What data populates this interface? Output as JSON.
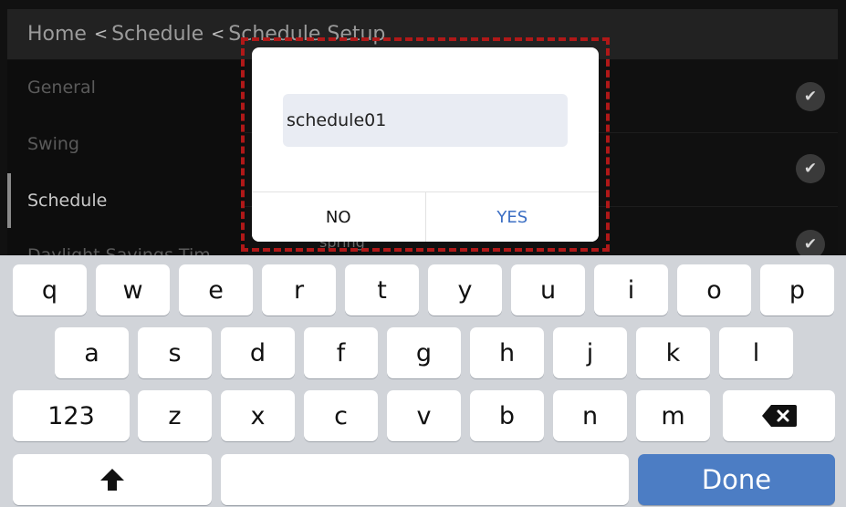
{
  "breadcrumb": {
    "home": "Home",
    "schedule": "Schedule",
    "current": "Schedule Setup",
    "separator": "<"
  },
  "sidebar": {
    "items": [
      {
        "label": "General"
      },
      {
        "label": "Swing"
      },
      {
        "label": "Schedule"
      },
      {
        "label": "Daylight Savings Tim"
      }
    ]
  },
  "list": {
    "peek_text": "spring",
    "check_icon": "checkmark-icon"
  },
  "dialog": {
    "input_value": "schedule01",
    "no_label": "NO",
    "yes_label": "YES"
  },
  "keyboard": {
    "row1": [
      "q",
      "w",
      "e",
      "r",
      "t",
      "y",
      "u",
      "i",
      "o",
      "p"
    ],
    "row2": [
      "a",
      "s",
      "d",
      "f",
      "g",
      "h",
      "j",
      "k",
      "l"
    ],
    "row3_mode": "123",
    "row3": [
      "z",
      "x",
      "c",
      "v",
      "b",
      "n",
      "m"
    ],
    "done_label": "Done",
    "shift_icon": "shift-icon",
    "backspace_icon": "backspace-icon"
  },
  "colors": {
    "accent_blue": "#4c7dc4",
    "yes_text": "#3c6fc4",
    "dialog_highlight": "#b01818"
  }
}
